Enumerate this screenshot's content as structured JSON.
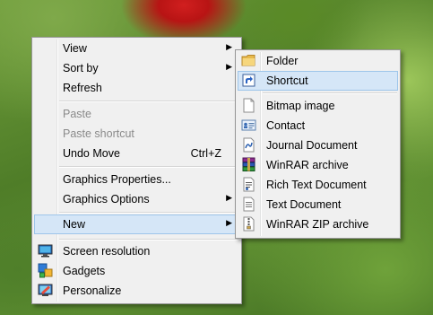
{
  "context_menu": {
    "view": "View",
    "sort_by": "Sort by",
    "refresh": "Refresh",
    "paste": "Paste",
    "paste_shortcut": "Paste shortcut",
    "undo_move": "Undo Move",
    "undo_move_shortcut": "Ctrl+Z",
    "graphics_properties": "Graphics Properties...",
    "graphics_options": "Graphics Options",
    "new": "New",
    "screen_resolution": "Screen resolution",
    "gadgets": "Gadgets",
    "personalize": "Personalize"
  },
  "new_submenu": {
    "folder": "Folder",
    "shortcut": "Shortcut",
    "bitmap_image": "Bitmap image",
    "contact": "Contact",
    "journal_document": "Journal Document",
    "winrar_archive": "WinRAR archive",
    "rich_text_document": "Rich Text Document",
    "text_document": "Text Document",
    "winrar_zip_archive": "WinRAR ZIP archive"
  },
  "submenu_arrow": "▶",
  "colors": {
    "menu_background": "#f0f0f0",
    "highlight": "#d5e6f7",
    "disabled_text": "#8a8a8a"
  },
  "icons": [
    "screen-resolution-icon",
    "gadgets-icon",
    "personalize-icon",
    "folder-icon",
    "shortcut-icon",
    "bitmap-image-icon",
    "contact-icon",
    "journal-document-icon",
    "winrar-archive-icon",
    "rich-text-document-icon",
    "text-document-icon",
    "winrar-zip-archive-icon"
  ]
}
